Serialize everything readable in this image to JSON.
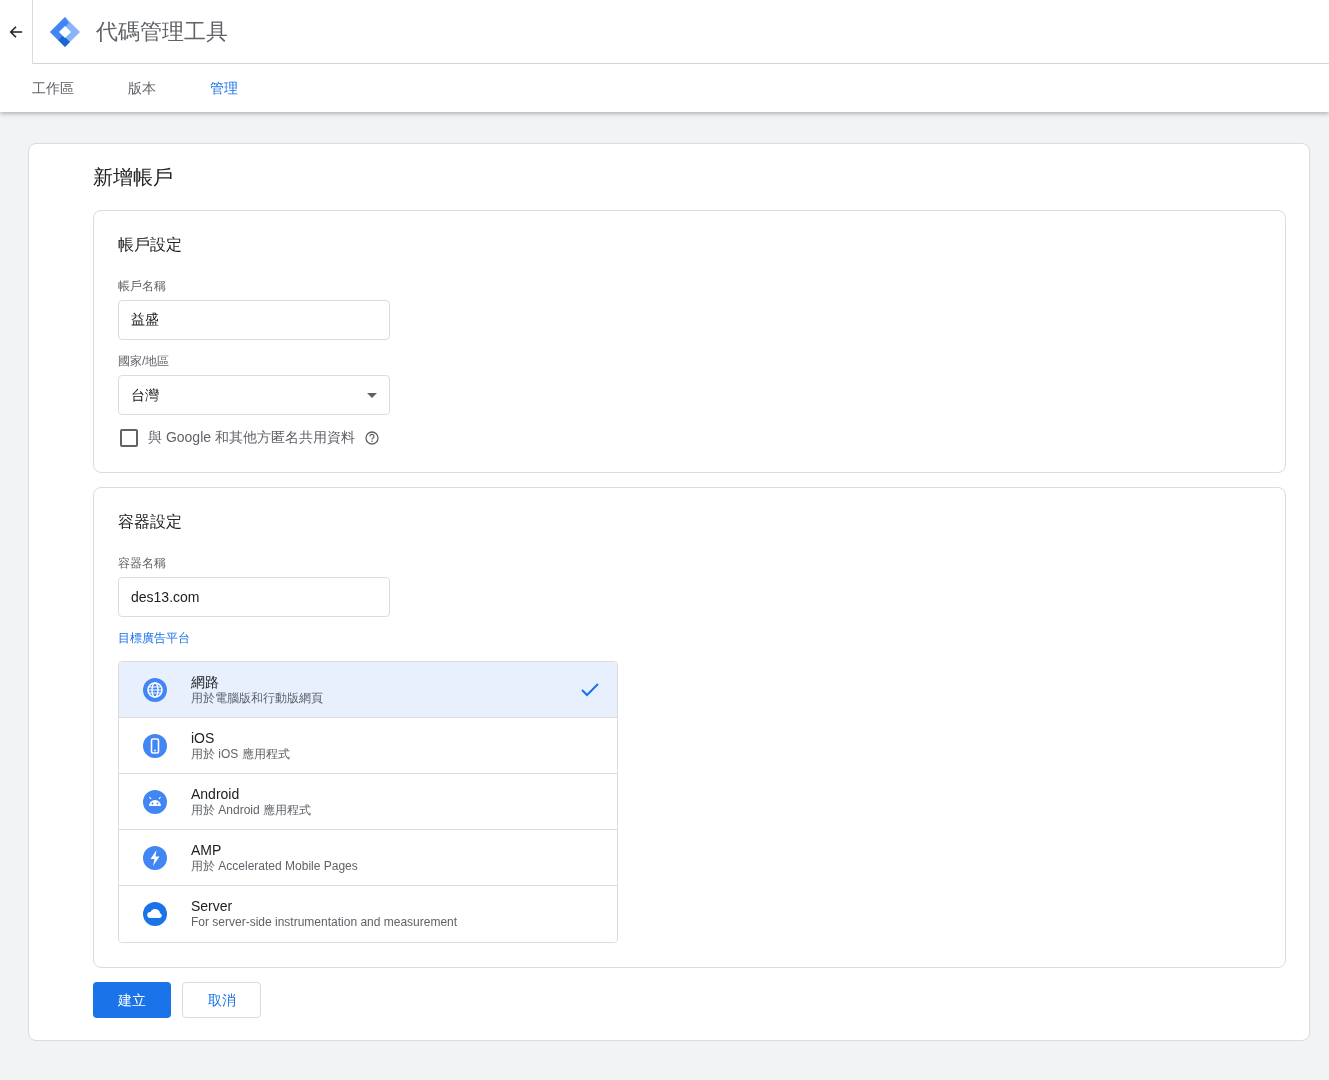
{
  "header": {
    "title": "代碼管理工具"
  },
  "tabs": [
    {
      "label": "工作區",
      "selected": false
    },
    {
      "label": "版本",
      "selected": false
    },
    {
      "label": "管理",
      "selected": true
    }
  ],
  "page": {
    "title": "新增帳戶"
  },
  "account_settings": {
    "title": "帳戶設定",
    "name_label": "帳戶名稱",
    "name_value": "益盛",
    "country_label": "國家/地區",
    "country_value": "台灣",
    "share_label": "與 Google 和其他方匿名共用資料",
    "share_checked": false
  },
  "container_settings": {
    "title": "容器設定",
    "name_label": "容器名稱",
    "name_value": "des13.com",
    "platform_label": "目標廣告平台",
    "platforms": [
      {
        "kind": "web",
        "name": "網路",
        "description": "用於電腦版和行動版網頁",
        "selected": true
      },
      {
        "kind": "ios",
        "name": "iOS",
        "description": "用於 iOS 應用程式",
        "selected": false
      },
      {
        "kind": "android",
        "name": "Android",
        "description": "用於 Android 應用程式",
        "selected": false
      },
      {
        "kind": "amp",
        "name": "AMP",
        "description": "用於 Accelerated Mobile Pages",
        "selected": false
      },
      {
        "kind": "server",
        "name": "Server",
        "description": "For server-side instrumentation and measurement",
        "selected": false
      }
    ]
  },
  "buttons": [
    {
      "kind": "primary",
      "label": "建立"
    },
    {
      "kind": "secondary",
      "label": "取消"
    }
  ]
}
